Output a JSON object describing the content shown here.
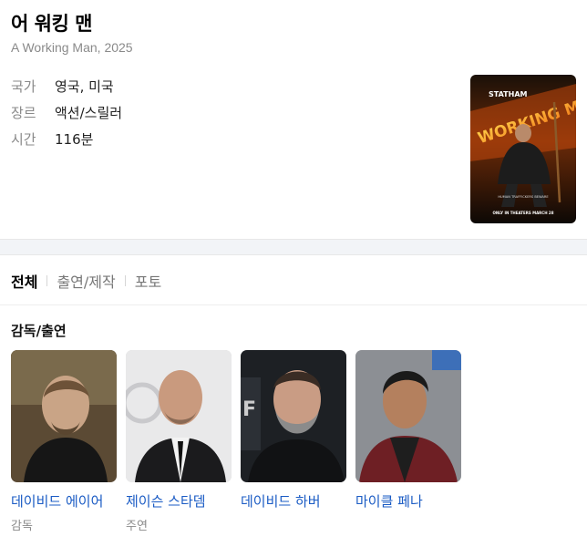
{
  "movie": {
    "title": "어 워킹 맨",
    "subtitle": "A Working Man, 2025",
    "info": [
      {
        "label": "국가",
        "value": "영국, 미국"
      },
      {
        "label": "장르",
        "value": "액션/스릴러"
      },
      {
        "label": "시간",
        "value": "116분"
      }
    ],
    "poster": {
      "top_text": "STATHAM",
      "title_text": "WORKING MAN",
      "tagline": "HUMAN TRAFFICKERS BEWARE",
      "footer": "ONLY IN THEATERS MARCH 28"
    }
  },
  "tabs": [
    "전체",
    "출연/제작",
    "포토"
  ],
  "active_tab": "전체",
  "cast_section": {
    "title": "감독/출연",
    "people": [
      {
        "name": "데이비드 에이어",
        "role": "감독"
      },
      {
        "name": "제이슨 스타뎀",
        "role": "주연"
      },
      {
        "name": "데이비드 하버",
        "role": ""
      },
      {
        "name": "마이클 페나",
        "role": ""
      }
    ]
  },
  "colors": {
    "link": "#1a5bc4",
    "muted": "#8a8a8a",
    "divider_band": "#f2f4f7"
  }
}
